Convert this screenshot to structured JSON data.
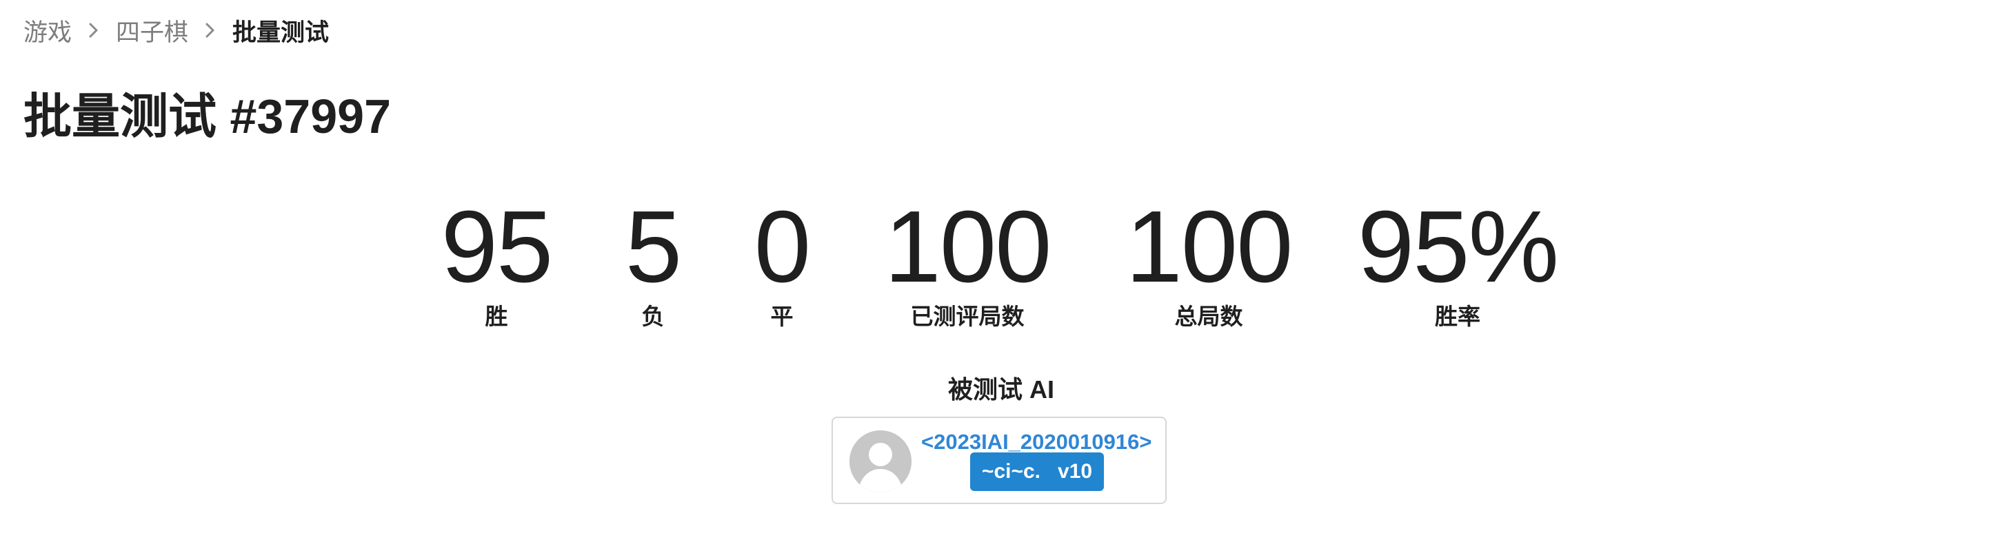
{
  "breadcrumb": {
    "items": [
      "游戏",
      "四子棋"
    ],
    "current": "批量测试",
    "separator_icon": "chevron-right-icon"
  },
  "page": {
    "title": "批量测试 #37997"
  },
  "stats": [
    {
      "value": "95",
      "label": "胜"
    },
    {
      "value": "5",
      "label": "负"
    },
    {
      "value": "0",
      "label": "平"
    },
    {
      "value": "100",
      "label": "已测评局数"
    },
    {
      "value": "100",
      "label": "总局数"
    },
    {
      "value": "95%",
      "label": "胜率"
    }
  ],
  "tested_ai": {
    "section_title": "被测试 AI",
    "avatar_icon": "user-avatar-icon",
    "name": "<2023IAI_2020010916>",
    "version": "~ci~c.   v10"
  },
  "colors": {
    "text": "#1f1f1f",
    "muted": "#7d7d7d",
    "link": "#2f86d6",
    "badge": "#2185d0",
    "border": "#d7d7d7"
  }
}
